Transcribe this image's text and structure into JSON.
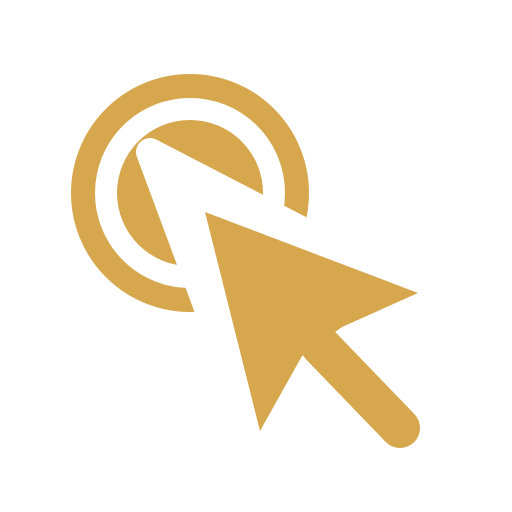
{
  "icon": {
    "name": "click-cursor-icon",
    "color": "#d6a74c",
    "background": "#ffffff"
  }
}
